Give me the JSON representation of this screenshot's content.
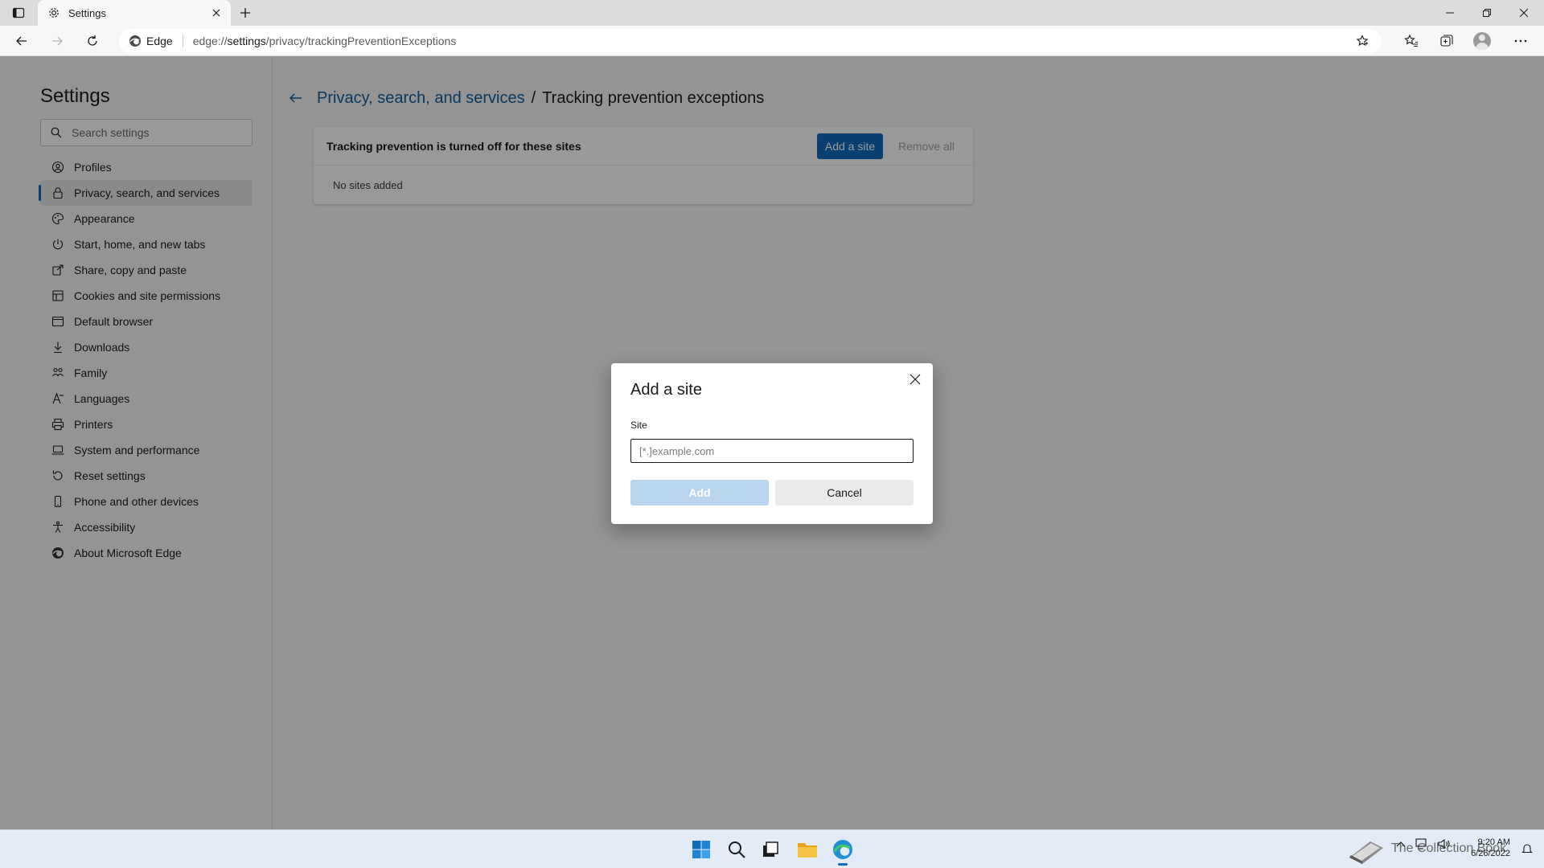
{
  "browser": {
    "tab_title": "Settings",
    "brand": "Edge",
    "url_prefix": "edge://",
    "url_host": "settings",
    "url_path": "/privacy/trackingPreventionExceptions"
  },
  "sidebar": {
    "title": "Settings",
    "search_placeholder": "Search settings",
    "items": [
      {
        "label": "Profiles",
        "icon": "profile-icon"
      },
      {
        "label": "Privacy, search, and services",
        "icon": "lock-icon"
      },
      {
        "label": "Appearance",
        "icon": "palette-icon"
      },
      {
        "label": "Start, home, and new tabs",
        "icon": "power-icon"
      },
      {
        "label": "Share, copy and paste",
        "icon": "share-icon"
      },
      {
        "label": "Cookies and site permissions",
        "icon": "cookie-icon"
      },
      {
        "label": "Default browser",
        "icon": "browser-icon"
      },
      {
        "label": "Downloads",
        "icon": "download-icon"
      },
      {
        "label": "Family",
        "icon": "family-icon"
      },
      {
        "label": "Languages",
        "icon": "language-icon"
      },
      {
        "label": "Printers",
        "icon": "printer-icon"
      },
      {
        "label": "System and performance",
        "icon": "laptop-icon"
      },
      {
        "label": "Reset settings",
        "icon": "reset-icon"
      },
      {
        "label": "Phone and other devices",
        "icon": "phone-icon"
      },
      {
        "label": "Accessibility",
        "icon": "accessibility-icon"
      },
      {
        "label": "About Microsoft Edge",
        "icon": "edge-logo-icon"
      }
    ]
  },
  "main": {
    "breadcrumb_parent": "Privacy, search, and services",
    "breadcrumb_separator": "/",
    "breadcrumb_current": "Tracking prevention exceptions",
    "card_label": "Tracking prevention is turned off for these sites",
    "add_site_button": "Add a site",
    "remove_all_button": "Remove all",
    "empty_text": "No sites added"
  },
  "dialog": {
    "title": "Add a site",
    "field_label": "Site",
    "placeholder": "[*.]example.com",
    "add_button": "Add",
    "cancel_button": "Cancel"
  },
  "taskbar": {
    "time": "9:20 AM",
    "date": "6/26/2022",
    "watermark": "The Collection Book"
  },
  "colors": {
    "accent": "#0f6cbd",
    "link": "#0f5e9f",
    "disabled_button": "#b8d4ee"
  }
}
